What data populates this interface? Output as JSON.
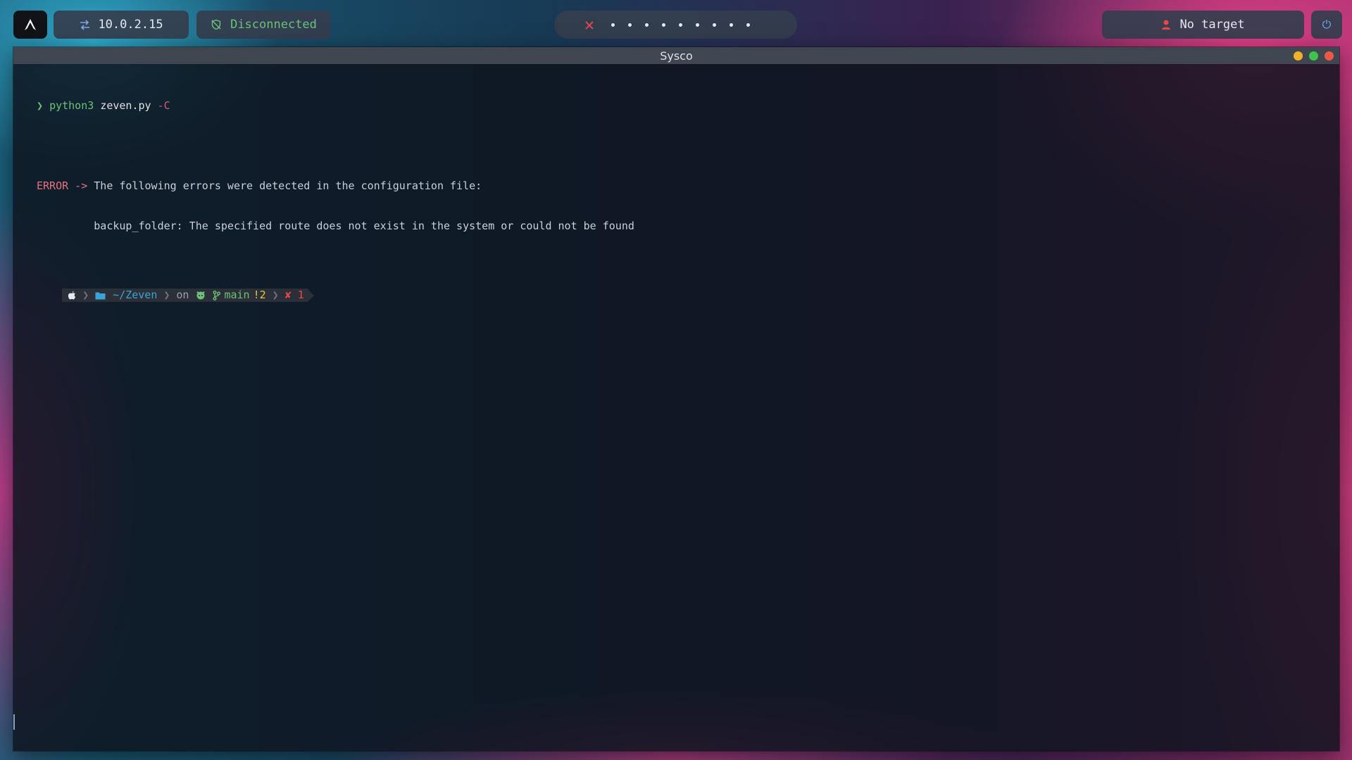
{
  "topbar": {
    "ip_address": "10.0.2.15",
    "vpn_status": "Disconnected",
    "workspace_dots": 10,
    "target_label": "No target"
  },
  "window": {
    "title": "Sysco"
  },
  "terminal": {
    "prompt_symbol": "❯",
    "command_name": "python3",
    "command_arg": "zeven.py",
    "command_flag": "-C",
    "error_tag": "ERROR ->",
    "error_line1": "The following errors were detected in the configuration file:",
    "error_line2": "backup_folder: The specified route does not exist in the system or could not be found",
    "powerline": {
      "dir": "~/Zeven",
      "on": "on",
      "branch": "main",
      "modified": "!2",
      "exit": "✘ 1"
    }
  },
  "colors": {
    "vpn_disconnected": "#6cc27a",
    "workspace_x": "#e5484d",
    "error": "#e5737f",
    "branch": "#6cc27a",
    "dir": "#3ba4d6"
  }
}
